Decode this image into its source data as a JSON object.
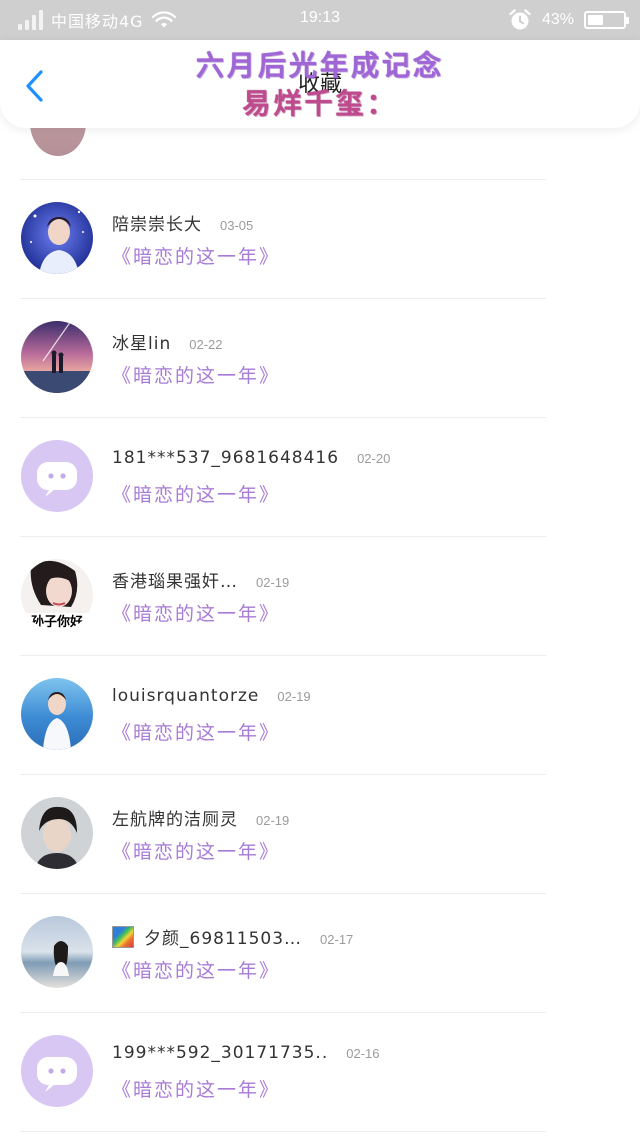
{
  "status_bar": {
    "carrier": "中国移动4G",
    "time": "19:13",
    "battery": "43%",
    "battery_level": 0.43
  },
  "header": {
    "title": "收藏",
    "overlay_line1": "六月后光年成记念",
    "overlay_line2": "易烊千玺："
  },
  "list": {
    "items": [
      {
        "name": "陪崇崇长大",
        "date": "03-05",
        "link": "《暗恋的这一年》",
        "avatar": "singer-photo"
      },
      {
        "name": "冰星lin",
        "date": "02-22",
        "link": "《暗恋的这一年》",
        "avatar": "anime-sky"
      },
      {
        "name": "181***537_9681648416",
        "date": "02-20",
        "link": "《暗恋的这一年》",
        "avatar": "default-chat-icon"
      },
      {
        "name": "香港瑙果强奸…",
        "date": "02-19",
        "link": "《暗恋的这一年》",
        "avatar": "girl-portrait",
        "avatar_caption": "孙子你好"
      },
      {
        "name": "louisrquantorze",
        "date": "02-19",
        "link": "《暗恋的这一年》",
        "avatar": "boy-sea"
      },
      {
        "name": "左航牌的洁厕灵",
        "date": "02-19",
        "link": "《暗恋的这一年》",
        "avatar": "boy-portrait"
      },
      {
        "name": "夕颜_69811503…",
        "date": "02-17",
        "link": "《暗恋的这一年》",
        "avatar": "girl-beach",
        "name_icon": "rainbow-flag-icon"
      },
      {
        "name": "199***592_30171735..",
        "date": "02-16",
        "link": "《暗恋的这一年》",
        "avatar": "default-chat-icon"
      }
    ]
  },
  "colors": {
    "accent_blue": "#1e90ff",
    "link_purple": "#a87bd6",
    "default_avatar_bg": "#d8c7f3",
    "status_bar_bg": "#cfcfcf"
  }
}
